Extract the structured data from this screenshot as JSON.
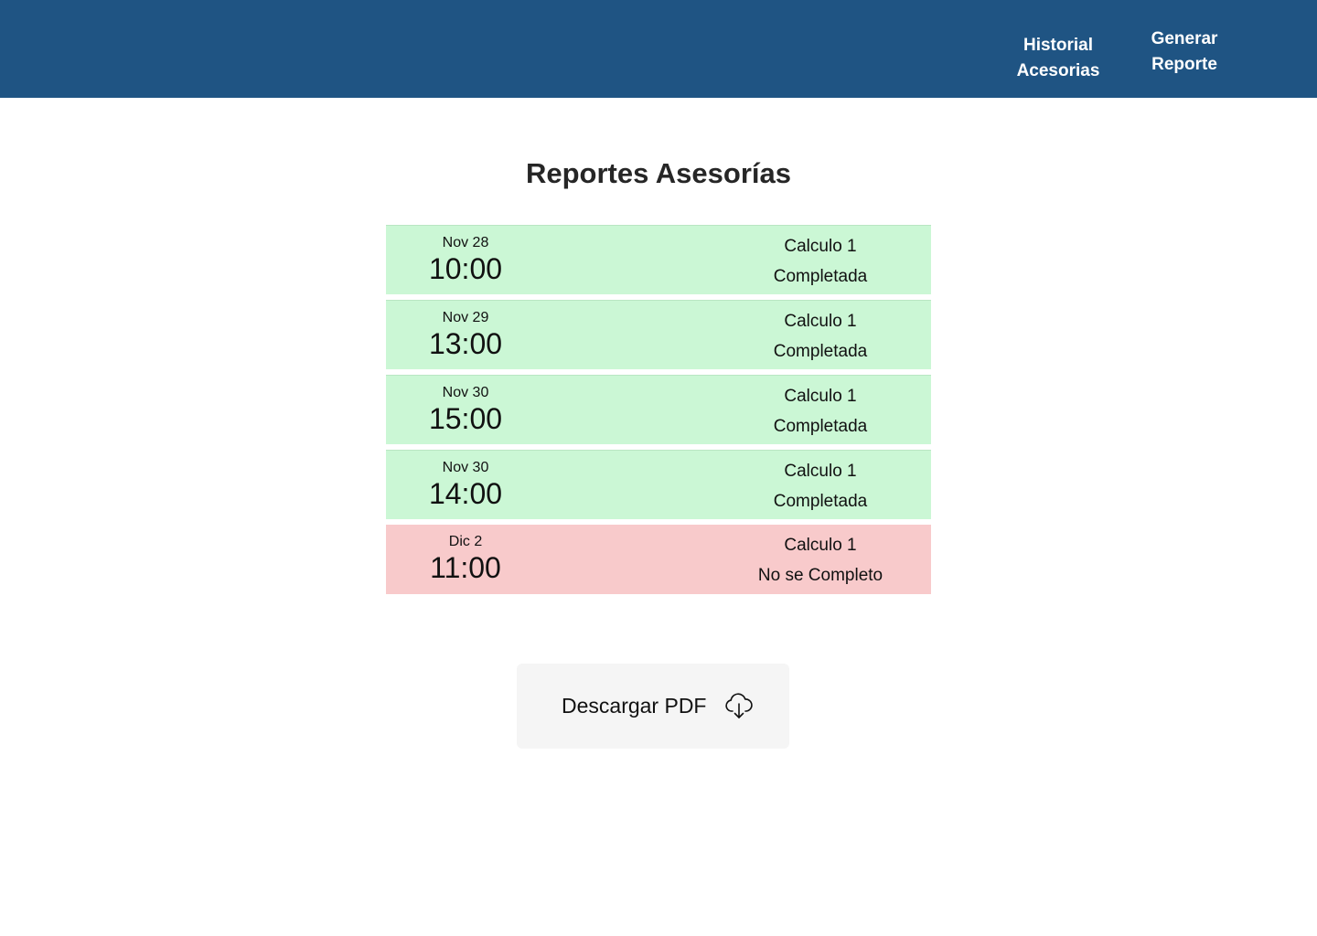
{
  "nav": {
    "historial_label": "Historial\nAcesorias",
    "generar_label": "Generar\nReporte"
  },
  "page": {
    "title": "Reportes Asesorías"
  },
  "reports": [
    {
      "date": "Nov 28",
      "time": "10:00",
      "subject": "Calculo 1",
      "status": "Completada",
      "state": "completed"
    },
    {
      "date": "Nov 29",
      "time": "13:00",
      "subject": "Calculo 1",
      "status": "Completada",
      "state": "completed"
    },
    {
      "date": "Nov 30",
      "time": "15:00",
      "subject": "Calculo 1",
      "status": "Completada",
      "state": "completed"
    },
    {
      "date": "Nov 30",
      "time": "14:00",
      "subject": "Calculo 1",
      "status": "Completada",
      "state": "completed"
    },
    {
      "date": "Dic 2",
      "time": "11:00",
      "subject": "Calculo 1",
      "status": "No se Completo",
      "state": "not-completed"
    }
  ],
  "download": {
    "label": "Descargar PDF",
    "icon": "cloud-download-icon"
  },
  "colors": {
    "header": "#1f5483",
    "completed": "#cbf7d5",
    "not_completed": "#f8cacb"
  }
}
